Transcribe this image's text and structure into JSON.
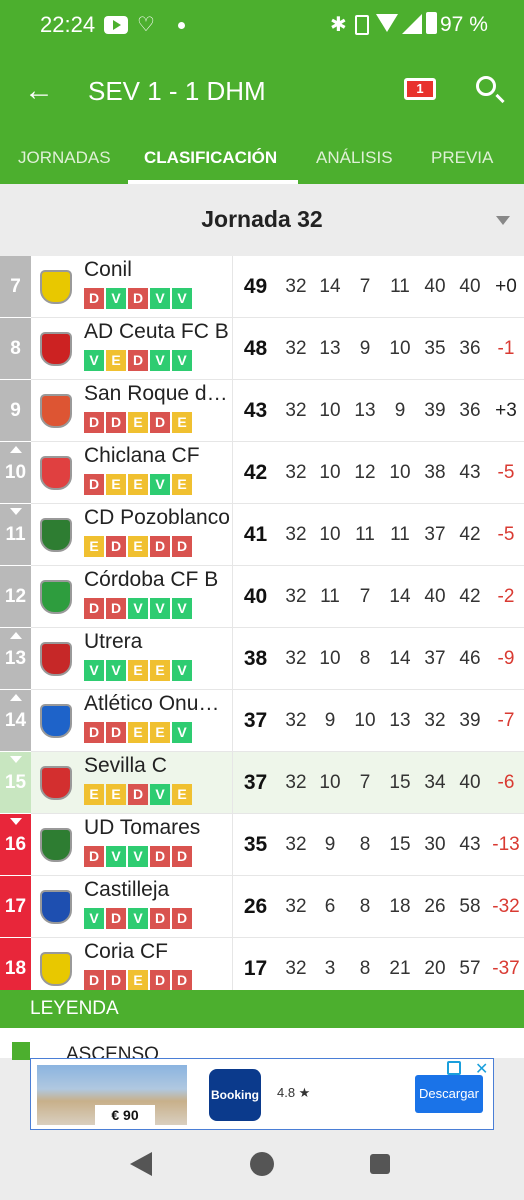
{
  "status_bar": {
    "time": "22:24",
    "battery": "97 %"
  },
  "app_bar": {
    "title": "SEV 1 - 1 DHM",
    "comments_count": "1"
  },
  "tabs": [
    {
      "label": "JORNADAS"
    },
    {
      "label": "CLASIFICACIÓN",
      "active": true
    },
    {
      "label": "ANÁLISIS"
    },
    {
      "label": "PREVIA"
    }
  ],
  "jornada": {
    "label": "Jornada 32"
  },
  "colors": {
    "green": "#4caf2e",
    "red": "#e8263a",
    "gray": "#b9b9b9",
    "win": "#2ecc71",
    "draw": "#f0c030",
    "loss": "#d9534f"
  },
  "standings": [
    {
      "pos": "7",
      "team": "Conil",
      "form": [
        "D",
        "V",
        "D",
        "V",
        "V"
      ],
      "pts": "49",
      "pj": "32",
      "g": "14",
      "e": "7",
      "p": "11",
      "gf": "40",
      "gc": "40",
      "dif": "+0",
      "trend": "",
      "zone": "gray",
      "crest": "#e8c800"
    },
    {
      "pos": "8",
      "team": "AD Ceuta FC B",
      "form": [
        "V",
        "E",
        "D",
        "V",
        "V"
      ],
      "pts": "48",
      "pj": "32",
      "g": "13",
      "e": "9",
      "p": "10",
      "gf": "35",
      "gc": "36",
      "dif": "-1",
      "trend": "",
      "zone": "gray",
      "crest": "#cc2222"
    },
    {
      "pos": "9",
      "team": "San Roque de Lepe",
      "form": [
        "D",
        "D",
        "E",
        "D",
        "E"
      ],
      "pts": "43",
      "pj": "32",
      "g": "10",
      "e": "13",
      "p": "9",
      "gf": "39",
      "gc": "36",
      "dif": "+3",
      "trend": "",
      "zone": "gray",
      "crest": "#dd5533"
    },
    {
      "pos": "10",
      "team": "Chiclana CF",
      "form": [
        "D",
        "E",
        "E",
        "V",
        "E"
      ],
      "pts": "42",
      "pj": "32",
      "g": "10",
      "e": "12",
      "p": "10",
      "gf": "38",
      "gc": "43",
      "dif": "-5",
      "trend": "up",
      "zone": "gray",
      "crest": "#e04040"
    },
    {
      "pos": "11",
      "team": "CD Pozoblanco",
      "form": [
        "E",
        "D",
        "E",
        "D",
        "D"
      ],
      "pts": "41",
      "pj": "32",
      "g": "10",
      "e": "11",
      "p": "11",
      "gf": "37",
      "gc": "42",
      "dif": "-5",
      "trend": "down",
      "zone": "gray",
      "crest": "#2e7d32"
    },
    {
      "pos": "12",
      "team": "Córdoba CF B",
      "form": [
        "D",
        "D",
        "V",
        "V",
        "V"
      ],
      "pts": "40",
      "pj": "32",
      "g": "11",
      "e": "7",
      "p": "14",
      "gf": "40",
      "gc": "42",
      "dif": "-2",
      "trend": "",
      "zone": "gray",
      "crest": "#2e9d3e"
    },
    {
      "pos": "13",
      "team": "Utrera",
      "form": [
        "V",
        "V",
        "E",
        "E",
        "V"
      ],
      "pts": "38",
      "pj": "32",
      "g": "10",
      "e": "8",
      "p": "14",
      "gf": "37",
      "gc": "46",
      "dif": "-9",
      "trend": "up",
      "zone": "gray",
      "crest": "#c62828"
    },
    {
      "pos": "14",
      "team": "Atlético Onubense",
      "form": [
        "D",
        "D",
        "E",
        "E",
        "V"
      ],
      "pts": "37",
      "pj": "32",
      "g": "9",
      "e": "10",
      "p": "13",
      "gf": "32",
      "gc": "39",
      "dif": "-7",
      "trend": "up",
      "zone": "gray",
      "crest": "#1e63c9"
    },
    {
      "pos": "15",
      "team": "Sevilla C",
      "form": [
        "E",
        "E",
        "D",
        "V",
        "E"
      ],
      "pts": "37",
      "pj": "32",
      "g": "10",
      "e": "7",
      "p": "15",
      "gf": "34",
      "gc": "40",
      "dif": "-6",
      "trend": "down",
      "zone": "lightgreen",
      "crest": "#d32f2f",
      "highlight": true
    },
    {
      "pos": "16",
      "team": "UD Tomares",
      "form": [
        "D",
        "V",
        "V",
        "D",
        "D"
      ],
      "pts": "35",
      "pj": "32",
      "g": "9",
      "e": "8",
      "p": "15",
      "gf": "30",
      "gc": "43",
      "dif": "-13",
      "trend": "down",
      "zone": "red",
      "crest": "#2e7d32"
    },
    {
      "pos": "17",
      "team": "Castilleja",
      "form": [
        "V",
        "D",
        "V",
        "D",
        "D"
      ],
      "pts": "26",
      "pj": "32",
      "g": "6",
      "e": "8",
      "p": "18",
      "gf": "26",
      "gc": "58",
      "dif": "-32",
      "trend": "",
      "zone": "red",
      "crest": "#1e4fb0"
    },
    {
      "pos": "18",
      "team": "Coria CF",
      "form": [
        "D",
        "D",
        "E",
        "D",
        "D"
      ],
      "pts": "17",
      "pj": "32",
      "g": "3",
      "e": "8",
      "p": "21",
      "gf": "20",
      "gc": "57",
      "dif": "-37",
      "trend": "",
      "zone": "red",
      "crest": "#e8c800"
    }
  ],
  "legend": {
    "title": "LEYENDA",
    "first_item": "ASCENSO"
  },
  "ad": {
    "price": "€ 90",
    "brand": "Booking",
    "rating": "4.8 ★",
    "cta": "Descargar"
  }
}
